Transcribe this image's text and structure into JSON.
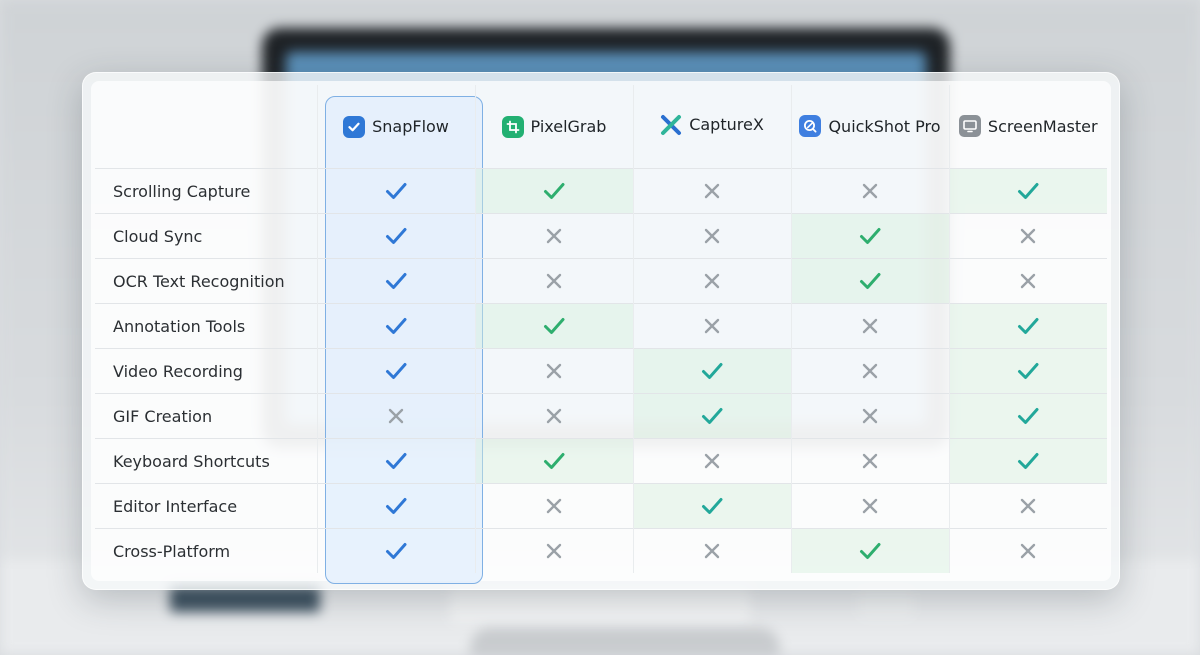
{
  "colors": {
    "check_primary": "#2f78d6",
    "check_green": "#2eae6e",
    "check_teal": "#22a89a",
    "cross": "#9aa1a7",
    "highlight_border": "#7fb0e4"
  },
  "products": [
    {
      "name": "SnapFlow",
      "icon": "snapflow-check-logo"
    },
    {
      "name": "PixelGrab",
      "icon": "pixelgrab-crop-logo"
    },
    {
      "name": "CaptureX",
      "icon": "capturex-x-logo"
    },
    {
      "name": "QuickShot Pro",
      "icon": "quickshot-lens-logo"
    },
    {
      "name": "ScreenMaster",
      "icon": "screenmaster-monitor-logo"
    }
  ],
  "features": [
    {
      "label": "Scrolling Capture",
      "values": [
        true,
        true,
        false,
        false,
        true
      ]
    },
    {
      "label": "Cloud Sync",
      "values": [
        true,
        false,
        false,
        true,
        false
      ]
    },
    {
      "label": "OCR Text Recognition",
      "values": [
        true,
        false,
        false,
        true,
        false
      ]
    },
    {
      "label": "Annotation Tools",
      "values": [
        true,
        true,
        false,
        false,
        true
      ]
    },
    {
      "label": "Video Recording",
      "values": [
        true,
        false,
        true,
        false,
        true
      ]
    },
    {
      "label": "GIF Creation",
      "values": [
        false,
        false,
        true,
        false,
        true
      ]
    },
    {
      "label": "Keyboard Shortcuts",
      "values": [
        true,
        true,
        false,
        false,
        true
      ]
    },
    {
      "label": "Editor Interface",
      "values": [
        true,
        false,
        true,
        false,
        false
      ]
    },
    {
      "label": "Cross-Platform",
      "values": [
        true,
        false,
        false,
        true,
        false
      ]
    }
  ]
}
